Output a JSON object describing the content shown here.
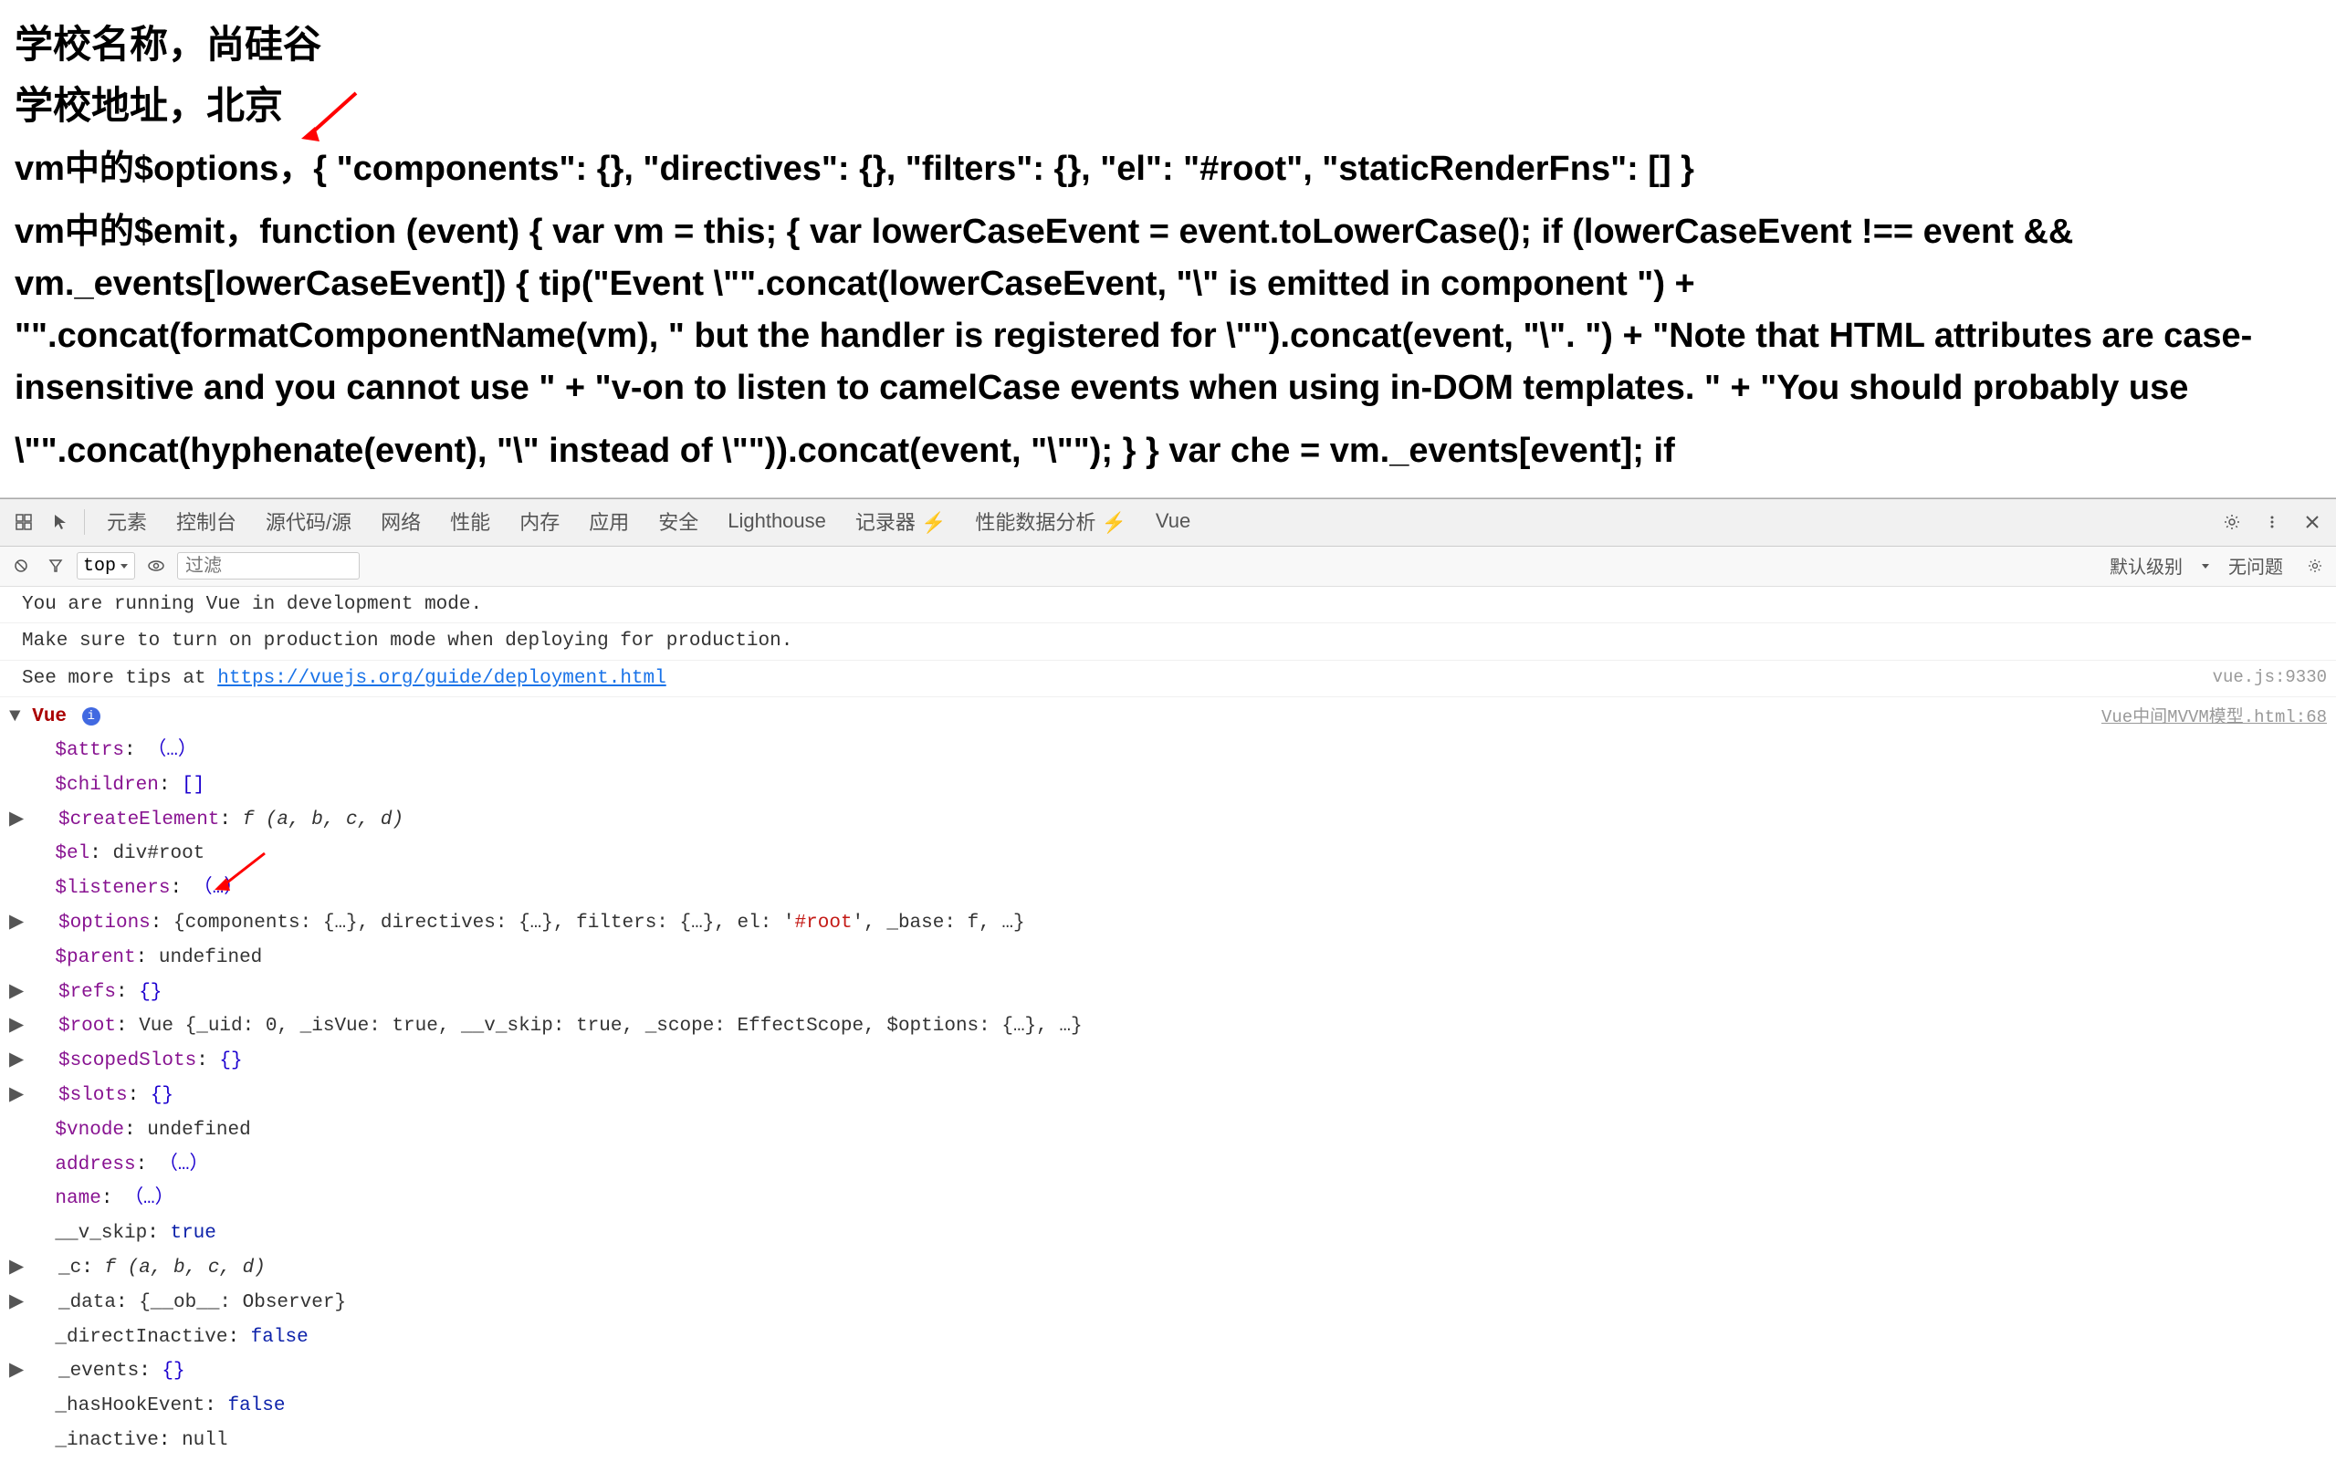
{
  "main": {
    "line1": "学校名称，尚硅谷",
    "line2": "学校地址，北京",
    "line3": "vm中的$options，{ \"components\": {}, \"directives\": {}, \"filters\": {}, \"el\": \"#root\", \"staticRenderFns\": [] }",
    "line4": "vm中的$emit，function (event) { var vm = this; { var lowerCaseEvent = event.toLowerCase(); if (lowerCaseEvent !== event && vm._events[lowerCaseEvent]) { tip(\"Event \\\"\".concat(lowerCaseEvent, \"\\\" is emitted in component \") + \"\".concat(formatComponentName(vm), \" but the handler is registered for \\\"\").concat(event, \"\\\". \") + \"Note that HTML attributes are case-insensitive and you cannot use \" + \"v-on to listen to camelCase events when using in-DOM templates. \" + \"You should probably use",
    "line4_cont": "\\\"\".\u0001concat(hyphenate(event), \"\\\" instead of \\\"\")).concat(event, \"\\\"\"); } } var che = vm._events[event]; if"
  },
  "devtools": {
    "tabs": [
      {
        "label": "元素",
        "active": false
      },
      {
        "label": "控制台",
        "active": false
      },
      {
        "label": "源代码/源",
        "active": false
      },
      {
        "label": "网络",
        "active": false
      },
      {
        "label": "性能",
        "active": false
      },
      {
        "label": "内存",
        "active": false
      },
      {
        "label": "应用",
        "active": false
      },
      {
        "label": "安全",
        "active": false
      },
      {
        "label": "Lighthouse",
        "active": false
      },
      {
        "label": "记录器 ⚡",
        "active": false
      },
      {
        "label": "性能数据分析 ⚡",
        "active": false
      },
      {
        "label": "Vue",
        "active": false
      }
    ],
    "right_label1": "默认级别",
    "right_label2": "无问题",
    "toolbar_icons": [
      "inspect",
      "cursor",
      "more-vert",
      "close"
    ]
  },
  "console": {
    "filter_placeholder": "过滤",
    "top_label": "top",
    "messages": [
      {
        "text": "You are running Vue in development mode.",
        "right": ""
      },
      {
        "text": "Make sure to turn on production mode when deploying for production.",
        "right": ""
      },
      {
        "text": "See more tips at https://vuejs.org/guide/deployment.html",
        "right": "",
        "has_link": true,
        "link_text": "https://vuejs.org/guide/deployment.html",
        "right_link": "vue.js:9330"
      }
    ],
    "vue_object": {
      "header": "▼ Vue",
      "header_link": "Vue中间MVVM模型.html:68",
      "items": [
        {
          "indent": 1,
          "arrow": "",
          "name": "$attrs",
          "value": "（…）"
        },
        {
          "indent": 1,
          "arrow": "",
          "name": "$children",
          "value": "[]"
        },
        {
          "indent": 1,
          "arrow": "▶",
          "name": "$createElement",
          "value": "f (a, b, c, d)"
        },
        {
          "indent": 1,
          "arrow": "",
          "name": "$el",
          "value": "div#root"
        },
        {
          "indent": 1,
          "arrow": "",
          "name": "$listeners",
          "value": "（…）",
          "annotation": "red-arrow"
        },
        {
          "indent": 1,
          "arrow": "▶",
          "name": "$options",
          "value": "{components: {…}, directives: {…}, filters: {…}, el: '#root', _base: f, …}"
        },
        {
          "indent": 1,
          "arrow": "",
          "name": "$parent",
          "value": "undefined"
        },
        {
          "indent": 1,
          "arrow": "▶",
          "name": "$refs",
          "value": "{}"
        },
        {
          "indent": 1,
          "arrow": "▶",
          "name": "$root",
          "value": "Vue {_uid: 0, _isVue: true, __v_skip: true, _scope: EffectScope, $options: {…}, …}"
        },
        {
          "indent": 1,
          "arrow": "▶",
          "name": "$scopedSlots",
          "value": "{}"
        },
        {
          "indent": 1,
          "arrow": "▶",
          "name": "$slots",
          "value": "{}"
        },
        {
          "indent": 1,
          "arrow": "",
          "name": "$vnode",
          "value": "undefined"
        },
        {
          "indent": 1,
          "arrow": "",
          "name": "address",
          "value": "（…）"
        },
        {
          "indent": 1,
          "arrow": "",
          "name": "name",
          "value": "（…）"
        },
        {
          "indent": 1,
          "arrow": "",
          "name": "__v_skip",
          "value": "true"
        },
        {
          "indent": 1,
          "arrow": "▶",
          "name": "_c",
          "value": "f (a, b, c, d)"
        },
        {
          "indent": 1,
          "arrow": "▶",
          "name": "_data",
          "value": "{__ob__: Observer}"
        },
        {
          "indent": 1,
          "arrow": "",
          "name": "_directInactive",
          "value": "false"
        },
        {
          "indent": 1,
          "arrow": "▶",
          "name": "_events",
          "value": "{}"
        },
        {
          "indent": 1,
          "arrow": "",
          "name": "_hasHookEvent",
          "value": "false"
        },
        {
          "indent": 1,
          "arrow": "",
          "name": "_inactive",
          "value": "null"
        }
      ]
    }
  }
}
